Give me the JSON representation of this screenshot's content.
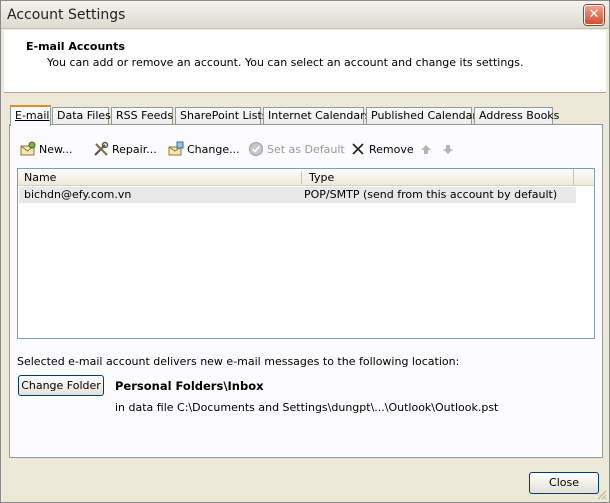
{
  "window": {
    "title": "Account Settings",
    "close_glyph": "✕"
  },
  "header": {
    "title": "E-mail Accounts",
    "description": "You can add or remove an account. You can select an account and change its settings."
  },
  "tabs": [
    {
      "label": "E-mail",
      "active": true
    },
    {
      "label": "Data Files"
    },
    {
      "label": "RSS Feeds"
    },
    {
      "label": "SharePoint Lists"
    },
    {
      "label": "Internet Calendars"
    },
    {
      "label": "Published Calendars"
    },
    {
      "label": "Address Books"
    }
  ],
  "toolbar": {
    "new_label": "New...",
    "repair_label": "Repair...",
    "change_label": "Change...",
    "set_default_label": "Set as Default",
    "remove_label": "Remove",
    "move_up_icon": "up-arrow-icon",
    "move_down_icon": "down-arrow-icon"
  },
  "accounts_list": {
    "columns": [
      "Name",
      "Type"
    ],
    "rows": [
      {
        "name": "bichdn@efy.com.vn",
        "type": "POP/SMTP (send from this account by default)"
      }
    ]
  },
  "delivery": {
    "description": "Selected e-mail account delivers new e-mail messages to the following location:",
    "change_folder_label": "Change Folder",
    "folder": "Personal Folders\\Inbox",
    "data_file": "in data file C:\\Documents and Settings\\dungpt\\...\\Outlook\\Outlook.pst"
  },
  "footer": {
    "close_label": "Close"
  },
  "colors": {
    "active_tab_accent": "#e68b2c",
    "dialog_bg": "#ece9d8",
    "selected_row": "#e8e8e8"
  }
}
